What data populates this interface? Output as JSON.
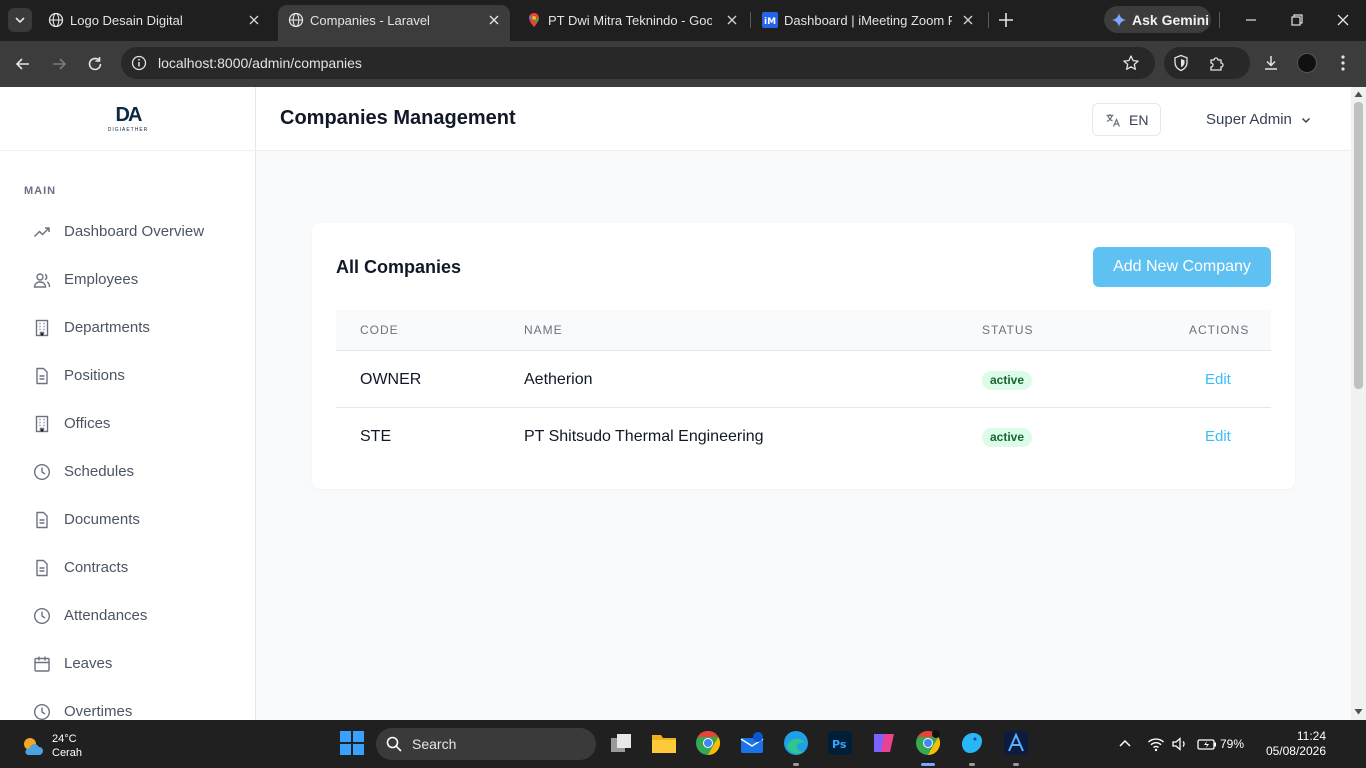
{
  "browser": {
    "tabs": [
      {
        "title": "Logo Desain Digital",
        "active": false
      },
      {
        "title": "Companies - Laravel",
        "active": true
      },
      {
        "title": "PT Dwi Mitra Teknindo - Google",
        "active": false
      },
      {
        "title": "Dashboard | iMeeting Zoom Pr",
        "active": false
      }
    ],
    "gemini_label": "Ask Gemini",
    "url": "localhost:8000/admin/companies"
  },
  "app": {
    "logo_mark": "DA",
    "logo_text": "DIGIAETHER",
    "sidebar": {
      "section_title": "MAIN",
      "items": [
        {
          "label": "Dashboard Overview",
          "icon": "trending-up-icon"
        },
        {
          "label": "Employees",
          "icon": "users-icon"
        },
        {
          "label": "Departments",
          "icon": "building-icon"
        },
        {
          "label": "Positions",
          "icon": "document-icon"
        },
        {
          "label": "Offices",
          "icon": "building-icon"
        },
        {
          "label": "Schedules",
          "icon": "clock-icon"
        },
        {
          "label": "Documents",
          "icon": "document-icon"
        },
        {
          "label": "Contracts",
          "icon": "document-icon"
        },
        {
          "label": "Attendances",
          "icon": "clock-icon"
        },
        {
          "label": "Leaves",
          "icon": "calendar-icon"
        },
        {
          "label": "Overtimes",
          "icon": "clock-icon"
        }
      ]
    },
    "header": {
      "title": "Companies Management",
      "language": "EN",
      "user": "Super Admin"
    },
    "card": {
      "title": "All Companies",
      "add_button": "Add New Company",
      "columns": [
        "CODE",
        "NAME",
        "STATUS",
        "ACTIONS"
      ],
      "rows": [
        {
          "code": "OWNER",
          "name": "Aetherion",
          "status": "active",
          "action": "Edit"
        },
        {
          "code": "STE",
          "name": "PT Shitsudo Thermal Engineering",
          "status": "active",
          "action": "Edit"
        }
      ]
    }
  },
  "taskbar": {
    "weather_temp": "24°C",
    "weather_desc": "Cerah",
    "search_label": "Search",
    "battery": "79%",
    "time": "11:24",
    "date": "05/08/2026"
  },
  "colors": {
    "accent": "#5ec1f2",
    "link": "#38bdf8",
    "badge_bg": "#dcfce7",
    "badge_text": "#166534"
  }
}
